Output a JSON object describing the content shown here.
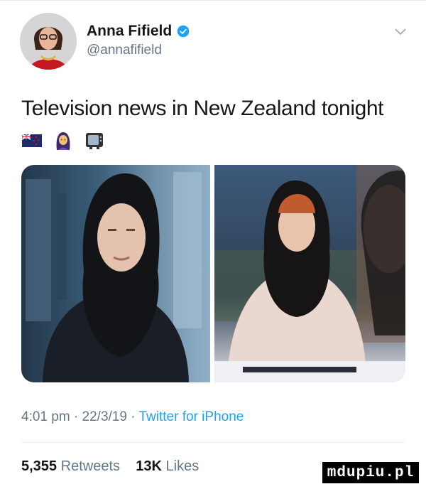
{
  "author": {
    "name": "Anna Fifield",
    "handle": "@annafifield"
  },
  "icons": {
    "verified": "verified-badge-icon",
    "more": "chevron-down-icon"
  },
  "tweet": {
    "text": "Television news in New Zealand tonight",
    "emojis": [
      "new-zealand-flag-emoji",
      "woman-with-headscarf-emoji",
      "television-emoji"
    ]
  },
  "meta": {
    "time": "4:01 pm",
    "date": "22/3/19",
    "source": "Twitter for iPhone",
    "sep": " · "
  },
  "stats": {
    "retweets_count": "5,355",
    "retweets_label": "Retweets",
    "likes_count": "13K",
    "likes_label": "Likes"
  },
  "watermark": "mdupiu.pl",
  "colors": {
    "link": "#1da1f2",
    "muted": "#657786",
    "text": "#14171a"
  }
}
